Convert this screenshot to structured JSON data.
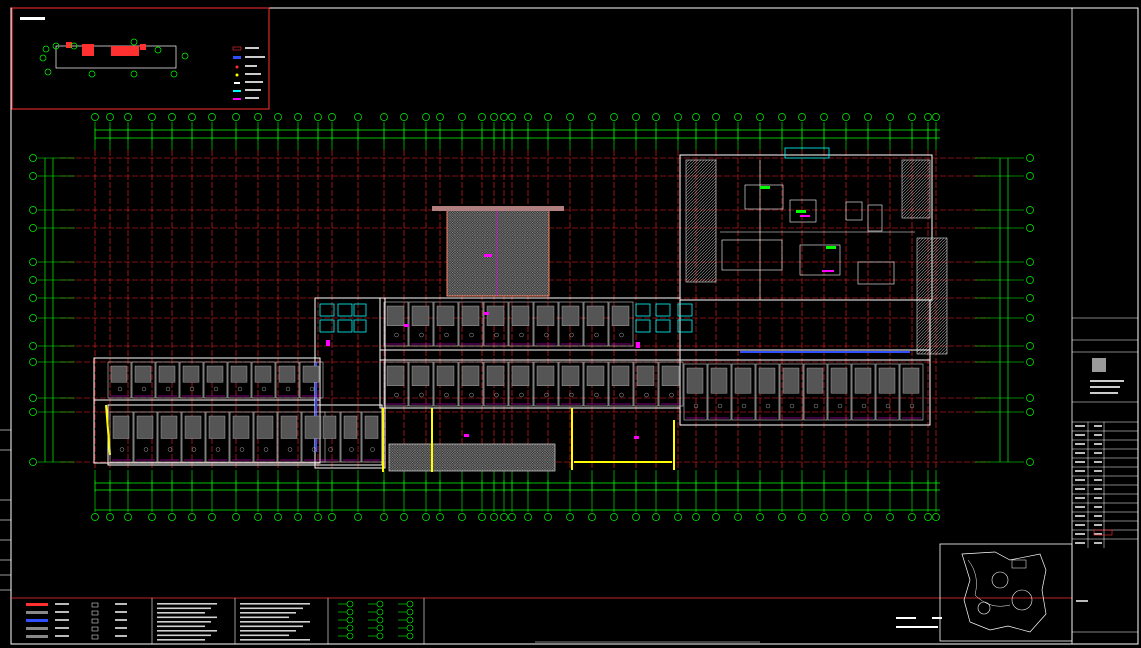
{
  "drawing": {
    "colors": {
      "background": "#000000",
      "frame": "#ffffff",
      "grid_axis": "#00ff00",
      "grid_line": "#ff0000",
      "wall": "#ffffff",
      "fixture": "#c8c8c8",
      "accent_magenta": "#ff00ff",
      "accent_blue": "#3050ff",
      "accent_yellow": "#ffff00",
      "accent_cyan": "#00ffff",
      "accent_orange": "#ff8000",
      "hatch": "#9a9a9a"
    }
  }
}
